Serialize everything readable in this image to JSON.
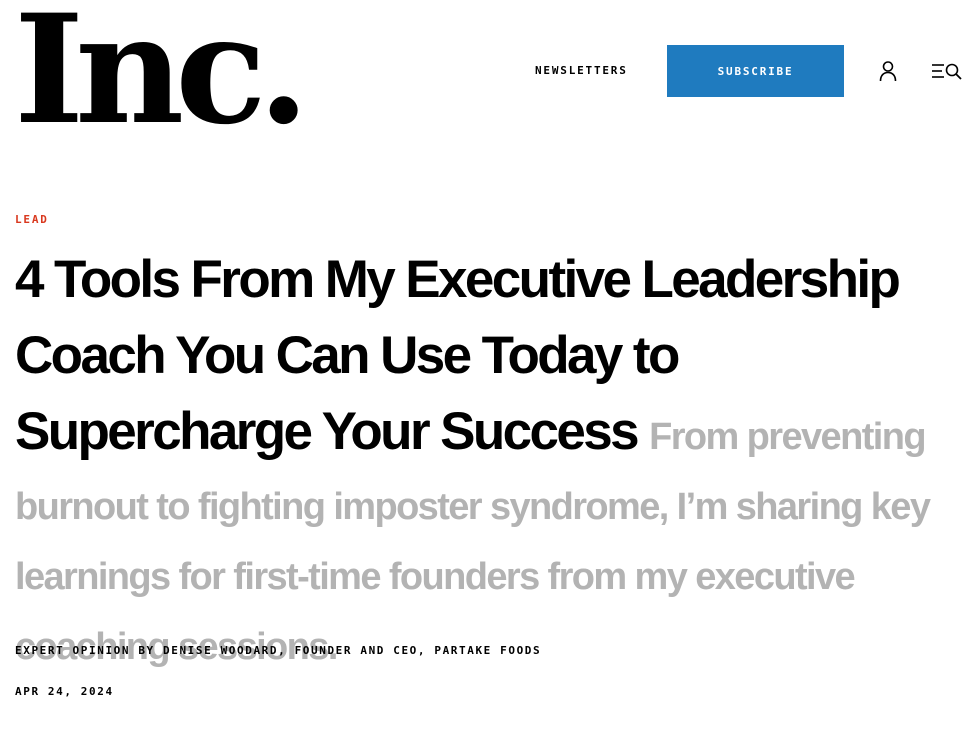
{
  "header": {
    "logo_text": "Inc.",
    "newsletters_label": "NEWSLETTERS",
    "subscribe_label": "SUBSCRIBE",
    "subscribe_color": "#1f7bbf",
    "account_icon": "user-icon",
    "menu_search_icon": "menu-search-icon"
  },
  "article": {
    "kicker": "LEAD",
    "kicker_color": "#d9381e",
    "headline": "4 Tools From My Executive Leadership Coach You Can Use Today to Supercharge Your Success",
    "dek": "From preventing burnout to fighting imposter syndrome, I’m sharing key learnings for first-time founders from my executive coaching sessions.",
    "dek_color": "#b3b3b3",
    "byline": "EXPERT OPINION BY DENISE WOODARD, FOUNDER AND CEO, PARTAKE FOODS",
    "date": "APR 24, 2024"
  }
}
